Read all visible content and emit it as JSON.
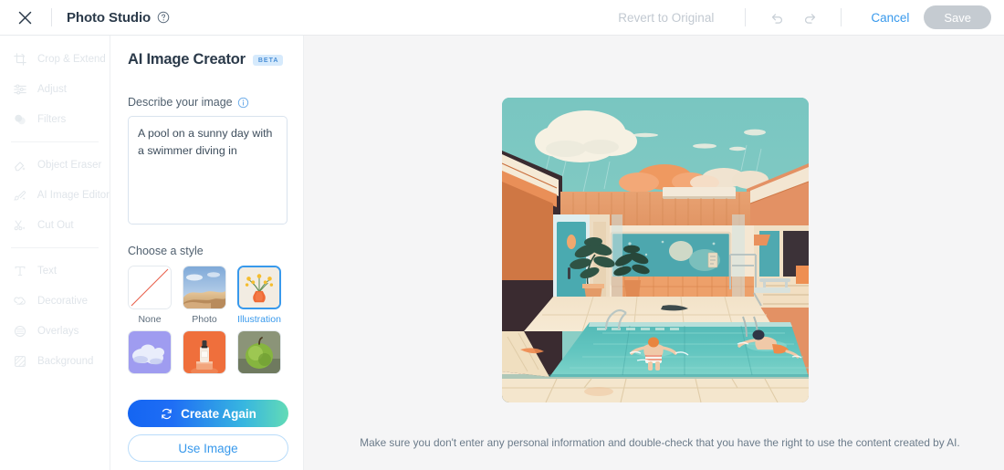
{
  "topbar": {
    "close_icon": "close-icon",
    "title": "Photo Studio",
    "help_icon": "help-circle-icon",
    "revert_label": "Revert to Original",
    "undo_icon": "undo-arrow-icon",
    "redo_icon": "redo-arrow-icon",
    "cancel_label": "Cancel",
    "save_label": "Save"
  },
  "sidebar": {
    "items": [
      {
        "label": "Crop & Extend",
        "icon": "crop-icon",
        "disabled": true
      },
      {
        "label": "Adjust",
        "icon": "sliders-icon",
        "disabled": true
      },
      {
        "label": "Filters",
        "icon": "filters-circles-icon",
        "disabled": true
      },
      {
        "label": "Object Eraser",
        "icon": "eraser-sparkle-icon",
        "disabled": true
      },
      {
        "label": "AI Image Editor",
        "icon": "brush-sparkle-icon",
        "disabled": true
      },
      {
        "label": "Cut Out",
        "icon": "scissors-sparkle-icon",
        "disabled": true
      },
      {
        "label": "Text",
        "icon": "text-t-icon",
        "disabled": true
      },
      {
        "label": "Decorative",
        "icon": "decorative-shape-icon",
        "disabled": true
      },
      {
        "label": "Overlays",
        "icon": "overlays-circle-icon",
        "disabled": true
      },
      {
        "label": "Background",
        "icon": "background-hatch-icon",
        "disabled": true
      }
    ]
  },
  "panel": {
    "title": "AI Image Creator",
    "badge": "BETA",
    "prompt_label": "Describe your image",
    "info_icon": "info-icon",
    "prompt_value": "A pool on a sunny day with a swimmer diving in",
    "prompt_placeholder": "Describe your image",
    "styles_label": "Choose a style",
    "styles": [
      {
        "name": "None",
        "thumb": "none-diagonal",
        "selected": false
      },
      {
        "name": "Photo",
        "thumb": "photo-desert",
        "selected": false
      },
      {
        "name": "Illustration",
        "thumb": "illustration-vase",
        "selected": true
      },
      {
        "name": "",
        "thumb": "3d-clouds",
        "selected": false
      },
      {
        "name": "",
        "thumb": "product-bottle",
        "selected": false
      },
      {
        "name": "",
        "thumb": "painting-apple",
        "selected": false
      }
    ],
    "create_label": "Create Again",
    "create_icon": "refresh-icon",
    "use_label": "Use Image"
  },
  "canvas": {
    "generated_image_alt": "pool-illustration",
    "disclaimer": "Make sure you don't enter any personal information and double-check that you have the right to use the content created by AI."
  },
  "colors": {
    "accent_blue": "#3899ec",
    "gradient_start": "#1465f2",
    "gradient_end": "#62dbb6",
    "badge_bg": "#d6eafc",
    "canvas_bg": "#f5f5f6",
    "title_ink": "#2b3a4a",
    "disabled": "#e0e5ea"
  }
}
